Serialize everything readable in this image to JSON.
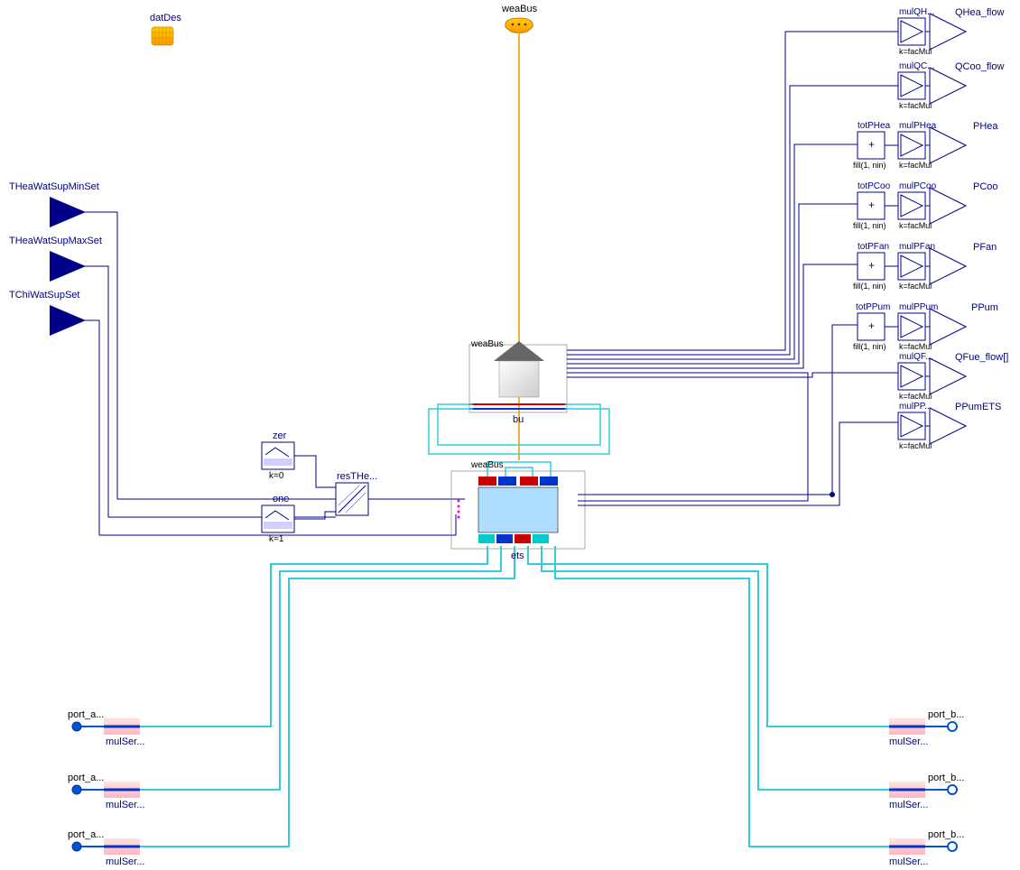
{
  "top": {
    "datDes": "datDes",
    "weaBus": "weaBus"
  },
  "inputs": {
    "theaMin": "THeaWatSupMinSet",
    "theaMax": "THeaWatSupMaxSet",
    "tchi": "TChiWatSupSet"
  },
  "left_blocks": {
    "zer": "zer",
    "zer_param": "k=0",
    "one": "one",
    "one_param": "k=1",
    "resT": "resTHe..."
  },
  "center": {
    "bui_weaBus": "weaBus",
    "bui": "bu",
    "ets_weaBus": "weaBus",
    "ets": "ets"
  },
  "outputs": [
    {
      "tot": "",
      "mul": "mulQH...",
      "k": "k=facMul",
      "out": "QHea_flow",
      "fill": ""
    },
    {
      "tot": "",
      "mul": "mulQC...",
      "k": "k=facMul",
      "out": "QCoo_flow",
      "fill": ""
    },
    {
      "tot": "totPHea",
      "mul": "mulPHea",
      "k": "k=facMul",
      "out": "PHea",
      "fill": "fill(1, nin)"
    },
    {
      "tot": "totPCoo",
      "mul": "mulPCoo",
      "k": "k=facMul",
      "out": "PCoo",
      "fill": "fill(1, nin)"
    },
    {
      "tot": "totPFan",
      "mul": "mulPFan",
      "k": "k=facMul",
      "out": "PFan",
      "fill": "fill(1, nin)"
    },
    {
      "tot": "totPPum",
      "mul": "mulPPum",
      "k": "k=facMul",
      "out": "PPum",
      "fill": "fill(1, nin)"
    },
    {
      "tot": "",
      "mul": "mulQF...",
      "k": "k=facMul",
      "out": "QFue_flow[]",
      "fill": ""
    },
    {
      "tot": "",
      "mul": "mulPP...",
      "k": "k=facMul",
      "out": "PPumETS",
      "fill": ""
    }
  ],
  "ports": {
    "a": "port_a...",
    "b": "port_b...",
    "mul": "mulSer..."
  }
}
